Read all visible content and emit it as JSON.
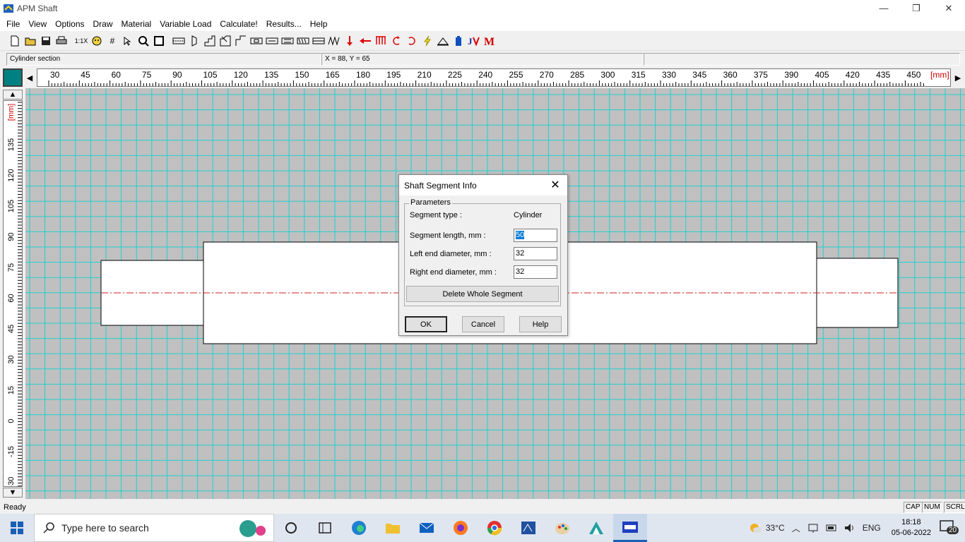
{
  "window": {
    "title": "APM Shaft",
    "minimize": "—",
    "maximize": "❐",
    "close": "✕"
  },
  "menu": [
    "File",
    "View",
    "Options",
    "Draw",
    "Material",
    "Variable Load",
    "Calculate!",
    "Results...",
    "Help"
  ],
  "toolbar": {
    "zoom_label": "1:1X",
    "icons": [
      "new-file-icon",
      "open-folder-icon",
      "save-icon",
      "print-icon",
      "zoom-1x-icon",
      "palette-icon",
      "grid-icon",
      "select-icon",
      "zoom-icon",
      "fit-icon",
      "cylinder-icon",
      "cone-icon",
      "step-icon",
      "chamfer-icon",
      "groove-icon",
      "keyway-icon",
      "spline-icon",
      "thread-icon",
      "bearing-icon",
      "gear-icon",
      "hole-icon",
      "force-icon",
      "moment-icon",
      "distributed-load-icon",
      "torque-icon",
      "rotate-icon",
      "lightning-icon",
      "support-icon",
      "material-icon",
      "calc-icon",
      "result-icon"
    ]
  },
  "info": {
    "mode": "Cylinder section",
    "coords": "X = 88, Y = 65"
  },
  "hruler": {
    "unit": "[mm]",
    "labels": [
      "30",
      "45",
      "60",
      "75",
      "90",
      "105",
      "120",
      "135",
      "150",
      "165",
      "180",
      "195",
      "210",
      "225",
      "240",
      "255",
      "270",
      "285",
      "300",
      "315",
      "330",
      "345",
      "360",
      "375",
      "390",
      "405",
      "420",
      "435",
      "450"
    ]
  },
  "vruler": {
    "unit": "[mm]",
    "labels": [
      "135",
      "120",
      "105",
      "90",
      "75",
      "60",
      "45",
      "30",
      "15",
      "0",
      "-15",
      "-30"
    ]
  },
  "status": {
    "text": "Ready",
    "cap": "CAP",
    "num": "NUM",
    "scrl": "SCRL"
  },
  "dialog": {
    "title": "Shaft Segment Info",
    "group_label": "Parameters",
    "segment_type_label": "Segment type :",
    "segment_type_value": "Cylinder",
    "length_label": "Segment length, mm :",
    "length_value": "50",
    "left_label": "Left end diameter, mm :",
    "left_value": "32",
    "right_label": "Right end diameter, mm :",
    "right_value": "32",
    "delete_label": "Delete Whole Segment",
    "ok": "OK",
    "cancel": "Cancel",
    "help": "Help"
  },
  "taskbar": {
    "search_placeholder": "Type here to search",
    "weather": "33°C",
    "lang": "ENG",
    "time": "18:18",
    "date": "05-06-2022",
    "notifications": "20"
  },
  "colors": {
    "grid": "#20d0d0",
    "canvas": "#c0c0c0",
    "centerline": "#d02020",
    "corner": "#008080"
  }
}
